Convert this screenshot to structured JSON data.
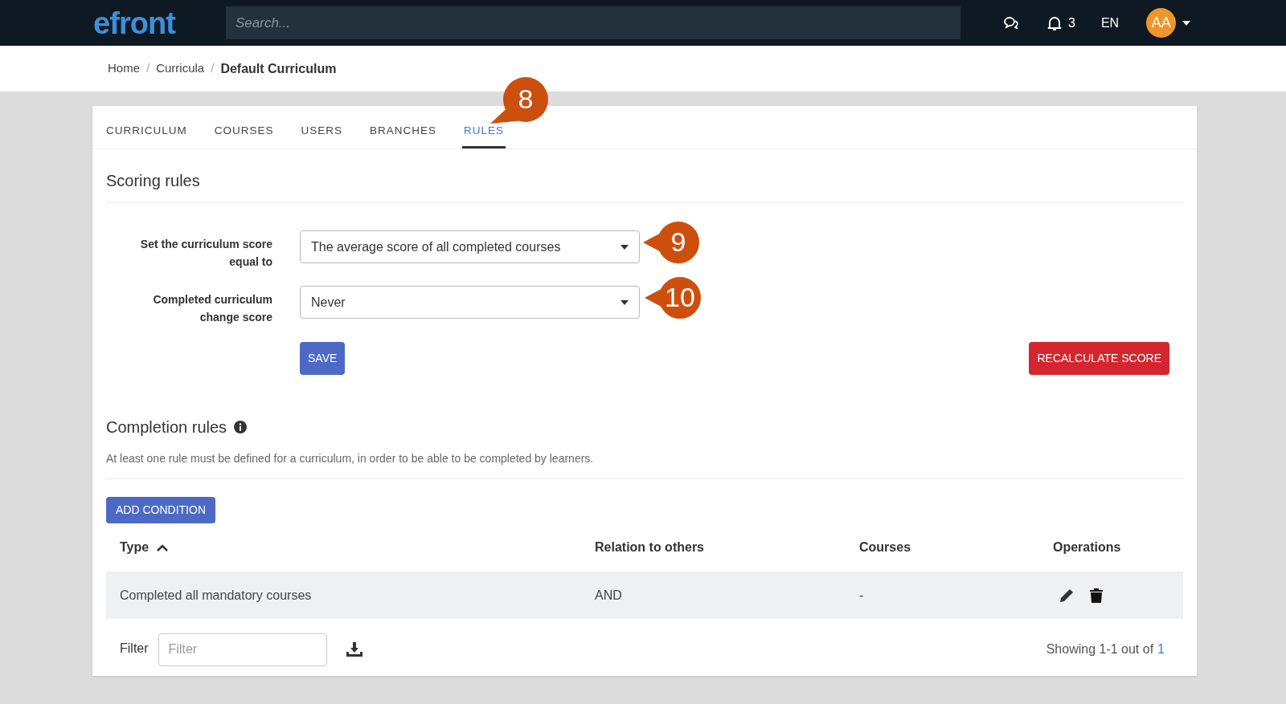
{
  "topbar": {
    "logo": "efront",
    "search": {
      "placeholder": "Search..."
    },
    "notifications": "3",
    "language": "EN",
    "avatar": "AA"
  },
  "breadcrumb": [
    {
      "label": "Home",
      "current": false,
      "separator": "/"
    },
    {
      "label": "Curricula",
      "current": false,
      "separator": "/"
    },
    {
      "label": "Default Curriculum",
      "current": true
    }
  ],
  "tabs": [
    {
      "label": "CURRICULUM",
      "selected": false
    },
    {
      "label": "COURSES",
      "selected": false
    },
    {
      "label": "USERS",
      "selected": false
    },
    {
      "label": "BRANCHES",
      "selected": false
    },
    {
      "label": "RULES",
      "selected": true
    }
  ],
  "scoring": {
    "title": "Scoring rules",
    "fields": [
      {
        "label": "Set the curriculum score equal to",
        "value": "The average score of all completed courses"
      },
      {
        "label": "Completed curriculum change score",
        "value": "Never"
      }
    ],
    "save": "SAVE",
    "recalculate": "RECALCULATE SCORE"
  },
  "completion": {
    "title": "Completion rules",
    "note": "At least one rule must be defined for a curriculum, in order to be able to be completed by learners.",
    "add": "ADD CONDITION",
    "table": {
      "columns": [
        {
          "label": "Type",
          "sorted": true
        },
        {
          "label": "Relation to others",
          "sorted": false
        },
        {
          "label": "Courses",
          "sorted": false
        },
        {
          "label": "Operations",
          "sorted": false
        }
      ],
      "rows": [
        {
          "cells": [
            "Completed all mandatory courses",
            "AND",
            "-"
          ]
        }
      ]
    },
    "filter": {
      "label": "Filter",
      "placeholder": "Filter"
    },
    "showing": "Showing 1-1 out of",
    "page": "1"
  },
  "callouts": [
    {
      "text": "8"
    },
    {
      "text": "9"
    },
    {
      "text": "10"
    }
  ]
}
